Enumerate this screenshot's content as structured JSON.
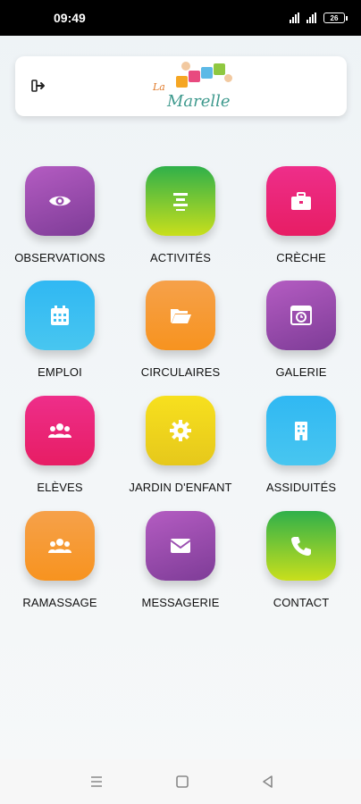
{
  "status_bar": {
    "time": "09:49",
    "battery": "26"
  },
  "header": {
    "logo_top": "La",
    "logo_name": "Marelle",
    "logout_icon": "logout-icon"
  },
  "menu": [
    {
      "label": "OBSERVATIONS",
      "icon": "eye-icon",
      "color": "#9b4fb0"
    },
    {
      "label": "ACTIVITÉS",
      "icon": "align-center-icon",
      "color": "#6cc23a"
    },
    {
      "label": "CRÈCHE",
      "icon": "briefcase-icon",
      "color": "#ea2577"
    },
    {
      "label": "EMPLOI",
      "icon": "calendar-icon",
      "color": "#3dbef2"
    },
    {
      "label": "CIRCULAIRES",
      "icon": "folder-open-icon",
      "color": "#f7981f"
    },
    {
      "label": "GALERIE",
      "icon": "calendar-clock-icon",
      "color": "#9b4fb0"
    },
    {
      "label": "ELÈVES",
      "icon": "users-icon",
      "color": "#ea2577"
    },
    {
      "label": "JARDIN D'ENFANT",
      "icon": "gear-icon",
      "color": "#efd31c"
    },
    {
      "label": "ASSIDUITÉS",
      "icon": "building-icon",
      "color": "#3dbef2"
    },
    {
      "label": "RAMASSAGE",
      "icon": "users-icon",
      "color": "#f7981f"
    },
    {
      "label": "MESSAGERIE",
      "icon": "envelope-icon",
      "color": "#9b4fb0"
    },
    {
      "label": "CONTACT",
      "icon": "phone-icon",
      "color": "#6cc23a"
    }
  ],
  "nav": {
    "menu_icon": "menu-icon",
    "home_icon": "home-square-icon",
    "back_icon": "back-triangle-icon"
  }
}
